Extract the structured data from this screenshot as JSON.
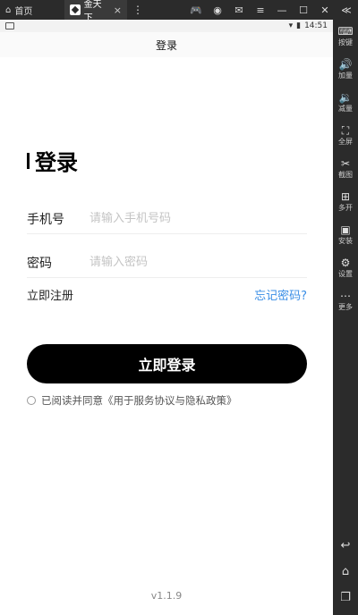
{
  "emulator": {
    "home_tab": "首页",
    "app_tab": "金天下",
    "collapse": "≪",
    "sidebar": [
      {
        "label": "按键",
        "icon": "keyboard-icon",
        "glyph": "⌨"
      },
      {
        "label": "加量",
        "icon": "volume-up-icon",
        "glyph": "🔊"
      },
      {
        "label": "减量",
        "icon": "volume-down-icon",
        "glyph": "🔉"
      },
      {
        "label": "全屏",
        "icon": "fullscreen-icon",
        "glyph": "⛶"
      },
      {
        "label": "截图",
        "icon": "scissors-icon",
        "glyph": "✂"
      },
      {
        "label": "多开",
        "icon": "multi-instance-icon",
        "glyph": "⊞"
      },
      {
        "label": "安装",
        "icon": "apk-install-icon",
        "glyph": "▣"
      },
      {
        "label": "设置",
        "icon": "gear-icon",
        "glyph": "⚙"
      },
      {
        "label": "更多",
        "icon": "more-icon",
        "glyph": "⋯"
      }
    ]
  },
  "status_bar": {
    "time": "14:51"
  },
  "header": {
    "title": "登录"
  },
  "login": {
    "heading": "登录",
    "phone_label": "手机号",
    "phone_placeholder": "请输入手机号码",
    "password_label": "密码",
    "password_placeholder": "请输入密码",
    "register_link": "立即注册",
    "forgot_link": "忘记密码?",
    "submit_label": "立即登录",
    "agreement_text": "已阅读并同意《用于服务协议与隐私政策》"
  },
  "footer": {
    "version": "v1.1.9"
  }
}
